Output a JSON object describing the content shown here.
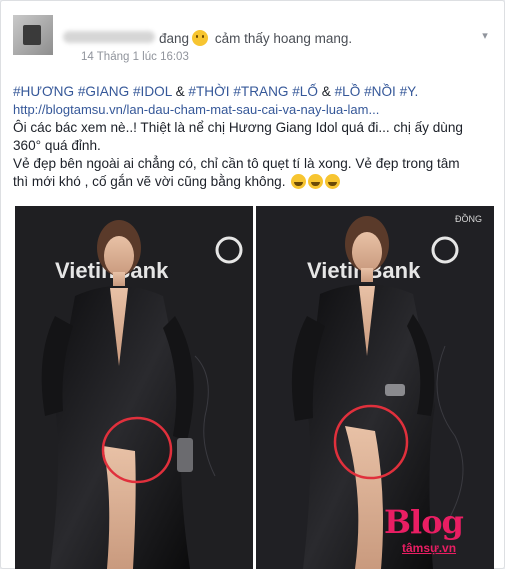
{
  "post": {
    "feeling_prefix": "đang",
    "feeling_text": "cảm thấy hoang mang.",
    "timestamp": "14 Tháng 1 lúc 16:03",
    "tags": [
      "#HƯƠNG",
      "#GIANG",
      "#IDOL",
      "&",
      "#THỜI",
      "#TRANG",
      "#LỐ",
      "&",
      "#LỒ",
      "#NỒI",
      "#Y."
    ],
    "link": "http://blogtamsu.vn/lan-dau-cham-mat-sau-cai-va-nay-lua-lam...",
    "line1": "Ôi các bác xem nè..! Thiệt là nể chị Hương Giang Idol quá đi... chị ấy dùng",
    "line2": "360° quá đỉnh.",
    "line3": "Vẻ đẹp bên ngoài ai chẳng có, chỉ cần tô quẹt tí là xong. Vẻ đẹp trong tâm",
    "line4": "thì mới khó , cố gắn vẽ vời cũng bằng không.",
    "emoji_count": 3
  },
  "photo": {
    "left_backdrop": "VietinBank",
    "right_backdrop": "VietinBank",
    "sponsor_text": "ĐỒNG",
    "watermark_main": "Blog",
    "watermark_sub": "tâmsự.vn",
    "highlight_color": "#e0303c"
  },
  "icons": {
    "chevron": "chevron-down-icon",
    "feeling_emoji": "confused-face-icon"
  }
}
